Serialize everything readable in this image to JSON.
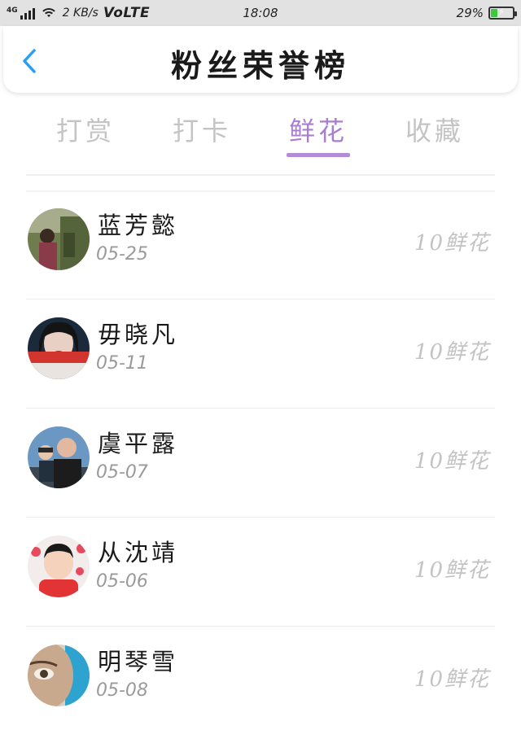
{
  "status_bar": {
    "network_tag": "4G",
    "speed": "2 KB/s",
    "volte": "VoLTE",
    "time": "18:08",
    "battery_percent": "29%",
    "battery_level": 0.29
  },
  "header": {
    "back_icon": "chevron-left-icon",
    "title": "粉丝荣誉榜"
  },
  "tabs": [
    {
      "label": "打赏",
      "active": false
    },
    {
      "label": "打卡",
      "active": false
    },
    {
      "label": "鲜花",
      "active": true
    },
    {
      "label": "收藏",
      "active": false
    }
  ],
  "colors": {
    "accent": "#b48bd8",
    "back_icon": "#2a9df4"
  },
  "fans": [
    {
      "name": "蓝芳懿",
      "date": "05-25",
      "amount": "10鲜花"
    },
    {
      "name": "毋晓凡",
      "date": "05-11",
      "amount": "10鲜花"
    },
    {
      "name": "虞平露",
      "date": "05-07",
      "amount": "10鲜花"
    },
    {
      "name": "从沈靖",
      "date": "05-06",
      "amount": "10鲜花"
    },
    {
      "name": "明琴雪",
      "date": "05-08",
      "amount": "10鲜花"
    }
  ]
}
